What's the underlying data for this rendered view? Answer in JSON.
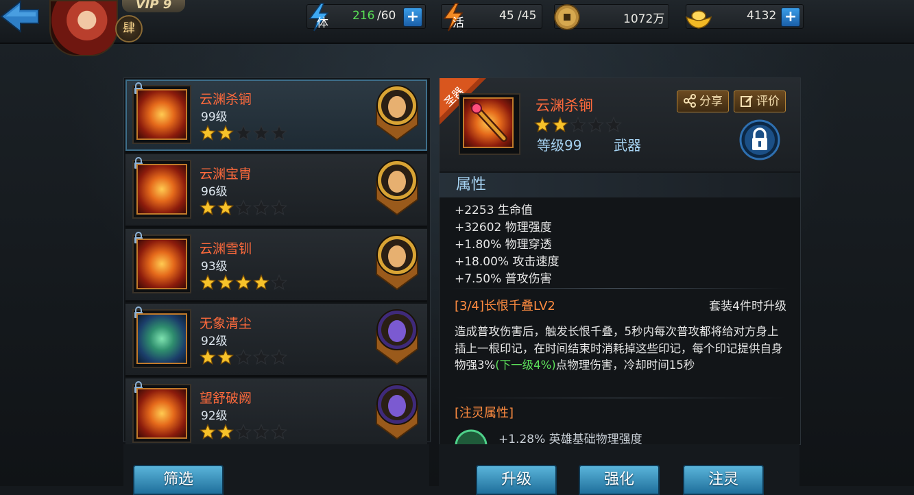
{
  "header": {
    "vip_label": "VIP 9",
    "rank_glyph": "肆",
    "resources": {
      "stamina": {
        "label": "体",
        "current": "216",
        "max": "/60",
        "icon": "lightning-icon"
      },
      "vitality": {
        "label": "活",
        "value": "45 /45",
        "icon": "fire-lightning-icon"
      },
      "coins": {
        "value": "1072万",
        "icon": "coin-icon"
      },
      "ingots": {
        "value": "4132",
        "icon": "gold-ingot-icon"
      }
    },
    "plus_label": "+"
  },
  "equipment_list": [
    {
      "name": "云渊杀锏",
      "level": "99级",
      "stars": 2,
      "max_stars": 5,
      "selected": true,
      "locked": true,
      "hero": "golden-hero"
    },
    {
      "name": "云渊宝胄",
      "level": "96级",
      "stars": 2,
      "max_stars": 5,
      "selected": false,
      "locked": true,
      "hero": "golden-hero"
    },
    {
      "name": "云渊雪钏",
      "level": "93级",
      "stars": 4,
      "max_stars": 5,
      "selected": false,
      "locked": true,
      "hero": "golden-hero"
    },
    {
      "name": "无象清尘",
      "level": "92级",
      "stars": 2,
      "max_stars": 5,
      "selected": false,
      "locked": true,
      "hero": "purple-hero"
    },
    {
      "name": "望舒破阙",
      "level": "92级",
      "stars": 2,
      "max_stars": 5,
      "selected": false,
      "locked": true,
      "hero": "purple-hero"
    }
  ],
  "filter_button": "筛选",
  "detail": {
    "tag": "圣器",
    "name": "云渊杀锏",
    "stars": 2,
    "max_stars": 5,
    "level_text": "等级99",
    "type_text": "武器",
    "share_label": "分享",
    "review_label": "评价",
    "section_attributes": "属性",
    "attributes": [
      "+2253 生命值",
      "+32602 物理强度",
      "+1.80% 物理穿透",
      "+18.00% 攻击速度",
      "+7.50% 普攻伤害"
    ],
    "set_name": "[3/4]长恨千叠LV2",
    "set_note": "套装4件时升级",
    "desc_part1": "造成普攻伤害后，触发长恨千叠，5秒内每次普攻都将给对方身上插上一根印记，在时间结束时消耗掉这些印记，每个印记提供自身物强3%",
    "desc_highlight": "(下一级4%)",
    "desc_part2": "点物理伤害，冷却时间15秒",
    "infuse_title": "[注灵属性]",
    "infuse_line": "+1.28% 英雄基础物理强度"
  },
  "actions": {
    "upgrade": "升级",
    "enhance": "强化",
    "infuse": "注灵"
  },
  "colors": {
    "item_name": "#ff6a3c",
    "accent_blue": "#a6d3f2",
    "highlight_green": "#5ce05a",
    "star_gold": "#f7c22a"
  }
}
